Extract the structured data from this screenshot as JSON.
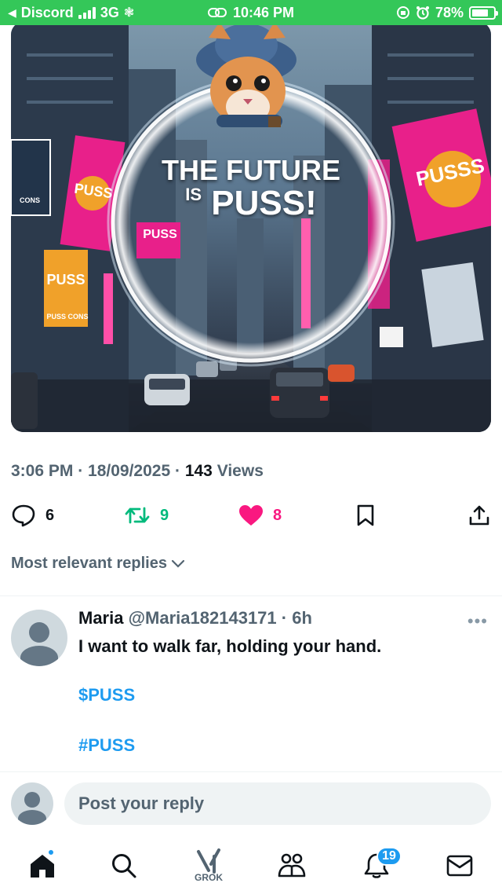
{
  "status_bar": {
    "back_app": "Discord",
    "network": "3G",
    "time": "10:46 PM",
    "battery": "78%",
    "battery_level": 0.78
  },
  "post": {
    "image_text": {
      "title_line1": "THE FUTURE",
      "title_is": "IS",
      "title_line2": "PUSS!",
      "sign_left": "PUSS",
      "sign_right": "PUSSS",
      "sign_center": "PUSS",
      "sign_small": "PUSS",
      "sign_cons": "PUSS CONS",
      "sign_cons2": "CONS"
    },
    "time": "3:06 PM",
    "date": "18/09/2025",
    "views_count": "143",
    "views_label": "Views",
    "replies": "6",
    "reposts": "9",
    "likes": "8",
    "colors": {
      "repost": "#00ba7c",
      "like": "#f91880",
      "link": "#1d9bf0"
    }
  },
  "replies_filter": "Most relevant replies",
  "reply": {
    "name": "Maria",
    "handle": "@Maria182143171",
    "time": "6h",
    "text": "I want to walk far, holding your hand.",
    "cashtag": "$PUSS",
    "hashtag": "#PUSS"
  },
  "composer": {
    "placeholder": "Post your reply"
  },
  "bottom_nav": {
    "grok_label": "GROK",
    "notifications_count": "19",
    "icons": [
      "home-icon",
      "search-icon",
      "grok-icon",
      "communities-icon",
      "notifications-icon",
      "messages-icon"
    ]
  }
}
